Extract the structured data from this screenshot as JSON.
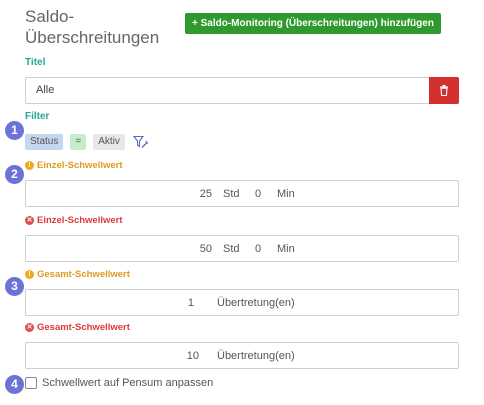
{
  "header": {
    "title": "Saldo-Überschreitungen",
    "add_button_label": "+ Saldo-Monitoring (Überschreitungen) hinzufügen",
    "add_button_color": "#2e9a2e"
  },
  "title_section": {
    "label": "Titel",
    "value": "Alle",
    "delete_icon": "trash-icon",
    "delete_color": "#d32f2f"
  },
  "filter_section": {
    "label": "Filter",
    "field": "Status",
    "operator": "=",
    "value": "Aktiv",
    "edit_icon": "filter-edit-icon"
  },
  "badges": [
    "1",
    "2",
    "3",
    "4"
  ],
  "thresholds": [
    {
      "label": "Einzel-Schwellwert",
      "level": "warning",
      "value1": "25",
      "unit1": "Std",
      "value2": "0",
      "unit2": "Min"
    },
    {
      "label": "Einzel-Schwellwert",
      "level": "error",
      "value1": "50",
      "unit1": "Std",
      "value2": "0",
      "unit2": "Min"
    },
    {
      "label": "Gesamt-Schwellwert",
      "level": "warning",
      "value1": "1",
      "unit1": "Übertretung(en)"
    },
    {
      "label": "Gesamt-Schwellwert",
      "level": "error",
      "value1": "10",
      "unit1": "Übertretung(en)"
    }
  ],
  "pensum_checkbox": {
    "label": "Schwellwert auf Pensum anpassen",
    "checked": false
  },
  "colors": {
    "accent_teal": "#26a69a",
    "warning": "#f0a81d",
    "error": "#de4c4c",
    "badge": "#6b74d6"
  }
}
